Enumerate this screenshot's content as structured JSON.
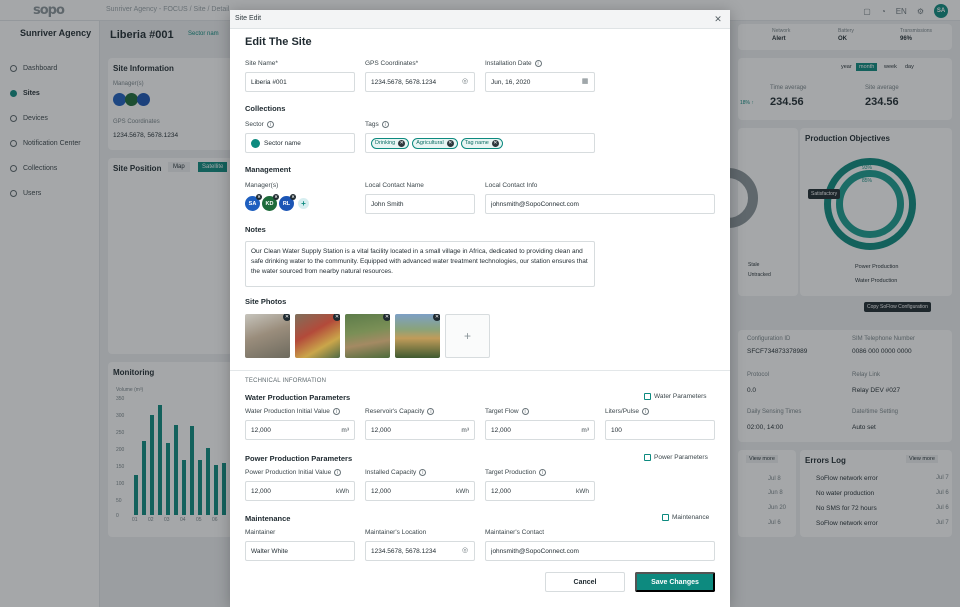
{
  "app": {
    "logo": "sopo",
    "breadcrumb": "Sunriver Agency - FOCUS / Site / Detail",
    "language": "EN",
    "user_initials": "SA"
  },
  "sidebar": {
    "agency": "Sunriver Agency",
    "items": [
      {
        "label": "Dashboard",
        "icon": "dashboard-icon"
      },
      {
        "label": "Sites",
        "icon": "location-pin-icon"
      },
      {
        "label": "Devices",
        "icon": "device-icon"
      },
      {
        "label": "Notification Center",
        "icon": "bell-icon"
      },
      {
        "label": "Collections",
        "icon": "collection-icon"
      },
      {
        "label": "Users",
        "icon": "user-icon"
      }
    ]
  },
  "background": {
    "site_title": "Liberia #001",
    "site_chip": "Sector nam",
    "site_info_title": "Site Information",
    "managers_label": "Manager(s)",
    "gps_label": "GPS Coordinates",
    "gps_value": "1234.5678, 5678.1234",
    "site_position_title": "Site Position",
    "map_tab": "Map",
    "satellite_tab": "Satellite",
    "monitoring_title": "Monitoring",
    "volume_label": "Volume (m³)",
    "y_ticks": [
      "350",
      "300",
      "250",
      "200",
      "150",
      "100",
      "50",
      "0"
    ],
    "x_ticks": [
      "01",
      "02",
      "03",
      "04",
      "05",
      "06"
    ],
    "kpi": [
      {
        "label": "Time average",
        "value": "234.56",
        "unit": "m³"
      },
      {
        "label": "Site average",
        "value": "234.56",
        "unit": "m³"
      }
    ],
    "kpi_small": "18% ↑",
    "period_tabs": [
      "year",
      "month",
      "week",
      "day"
    ],
    "production_objectives_title": "Production Objectives",
    "objective_pct_1": "93%",
    "objective_pct_2": "85%",
    "satisfactory_label": "Satisfactory",
    "legend_power": "Power Production",
    "legend_water": "Water Production",
    "legend_stale": "Stale",
    "legend_untracked": "Untracked",
    "copy_config_tooltip": "Copy SoFlow Configuration",
    "config": [
      {
        "label": "Configuration ID",
        "value": "SFCF734873378989"
      },
      {
        "label": "SIM Telephone Number",
        "value": "0086 000 0000 0000"
      },
      {
        "label": "Protocol",
        "value": "0.0"
      },
      {
        "label": "Relay Link",
        "value": "Relay DEV #027"
      },
      {
        "label": "Daily Sensing Times",
        "value": "02:00, 14:00"
      },
      {
        "label": "Date/time Setting",
        "value": "Auto set"
      }
    ],
    "status": [
      {
        "label": "Network",
        "value": "Alert"
      },
      {
        "label": "Battery",
        "value": "OK"
      },
      {
        "label": "Transmissions",
        "value": "96%"
      }
    ],
    "errors_title": "Errors Log",
    "view_more": "View more",
    "errors": [
      {
        "text": "SoFlow network error",
        "date": "Jul 7"
      },
      {
        "text": "No water production",
        "date": "Jul 6"
      },
      {
        "text": "No SMS for 72 hours",
        "date": "Jul 6"
      },
      {
        "text": "SoFlow network error",
        "date": "Jul 7"
      }
    ],
    "mid_dates": [
      "Jul 8",
      "Jun 8",
      "Jun 20",
      "Jul 6"
    ]
  },
  "modal": {
    "window_title": "Site Edit",
    "heading": "Edit The Site",
    "site_name": {
      "label": "Site Name*",
      "value": "Liberia #001"
    },
    "gps": {
      "label": "GPS Coordinates*",
      "value": "1234.5678, 5678.1234"
    },
    "install_date": {
      "label": "Installation Date",
      "value": "Jun, 16, 2020"
    },
    "collections_title": "Collections",
    "sector": {
      "label": "Sector",
      "placeholder": "Sector name"
    },
    "tags": {
      "label": "Tags",
      "items": [
        "Drinking",
        "Agricultural",
        "Tag name"
      ]
    },
    "management_title": "Management",
    "managers_label": "Manager(s)",
    "managers": [
      {
        "initials": "SA",
        "color": "#1e5fbf"
      },
      {
        "initials": "KD",
        "color": "#1d6b3a"
      },
      {
        "initials": "RL",
        "color": "#1b55b5"
      }
    ],
    "local_contact_name": {
      "label": "Local Contact Name",
      "value": "John Smith"
    },
    "local_contact_info": {
      "label": "Local Contact Info",
      "value": "johnsmith@SopoConnect.com"
    },
    "notes_title": "Notes",
    "notes_text": "Our Clean Water Supply Station is a vital facility located in a small village in Africa, dedicated to providing clean and safe drinking water to the community. Equipped with advanced water treatment technologies, our station ensures that the water sourced from nearby natural resources.",
    "photos_title": "Site Photos",
    "tech_info": "TECHNICAL INFORMATION",
    "water_title": "Water Production Parameters",
    "water_link": "Water Parameters",
    "water_fields": [
      {
        "label": "Water Production Initial Value",
        "value": "12,000",
        "unit": "m³"
      },
      {
        "label": "Reservoir's Capacity",
        "value": "12,000",
        "unit": "m³"
      },
      {
        "label": "Target Flow",
        "value": "12,000",
        "unit": "m³"
      },
      {
        "label": "Liters/Pulse",
        "value": "100",
        "unit": ""
      }
    ],
    "power_title": "Power Production Parameters",
    "power_link": "Power Parameters",
    "power_fields": [
      {
        "label": "Power Production Initial Value",
        "value": "12,000",
        "unit": "kWh"
      },
      {
        "label": "Installed Capacity",
        "value": "12,000",
        "unit": "kWh"
      },
      {
        "label": "Target Production",
        "value": "12,000",
        "unit": "kWh"
      }
    ],
    "maintenance_title": "Maintenance",
    "maintenance_link": "Maintenance",
    "maintainer": {
      "label": "Maintainer",
      "value": "Walter White"
    },
    "maintainer_location": {
      "label": "Maintainer's Location",
      "value": "1234.5678, 5678.1234"
    },
    "maintainer_contact": {
      "label": "Maintainer's Contact",
      "value": "johnsmith@SopoConnect.com"
    },
    "cancel_label": "Cancel",
    "save_label": "Save Changes"
  },
  "chart_data": {
    "type": "bar",
    "categories": [
      "01",
      "",
      "02",
      "",
      "03",
      "",
      "04",
      "",
      "05",
      "",
      "06",
      ""
    ],
    "values": [
      120,
      220,
      300,
      330,
      215,
      270,
      165,
      265,
      165,
      200,
      150,
      155
    ],
    "ylabel": "Volume (m³)",
    "ylim": [
      0,
      350
    ]
  }
}
